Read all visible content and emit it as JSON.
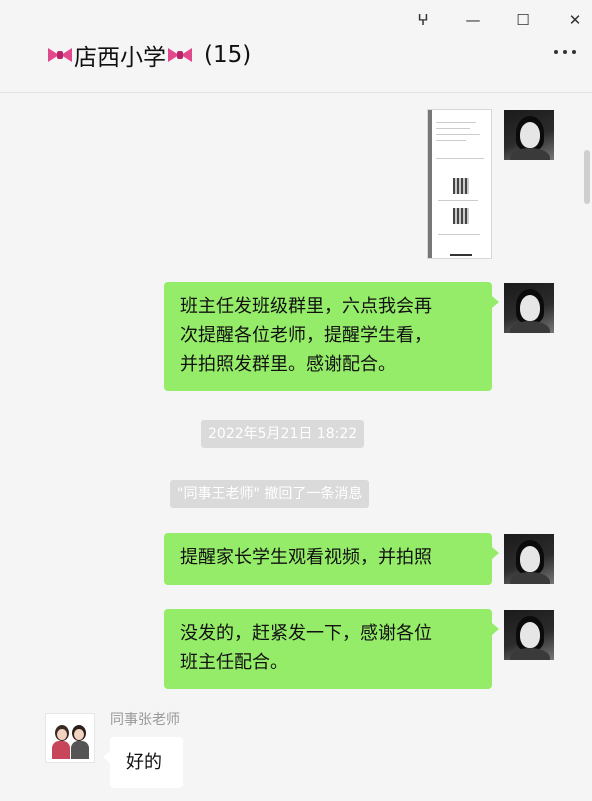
{
  "window": {
    "pin_icon": "pin-icon",
    "pin_glyph": "ⵖ",
    "minimize_icon": "minimize-icon",
    "minimize_glyph": "—",
    "maximize_icon": "maximize-icon",
    "maximize_glyph": "☐",
    "close_icon": "close-icon",
    "close_glyph": "✕"
  },
  "chat": {
    "title": "店西小学",
    "member_count": "(15)",
    "title_decoration_icon": "pink-bow-icon",
    "more_icon": "more-icon"
  },
  "messages": [
    {
      "type": "image",
      "direction": "out"
    },
    {
      "type": "text",
      "direction": "out",
      "lines": [
        "班主任发班级群里，六点我会再",
        "次提醒各位老师，提醒学生看，",
        "并拍照发群里。感谢配合。"
      ]
    },
    {
      "type": "time",
      "text": "2022年5月21日 18:22"
    },
    {
      "type": "system",
      "text": "\"同事王老师\" 撤回了一条消息"
    },
    {
      "type": "text",
      "direction": "out",
      "lines": [
        "提醒家长学生观看视频，并拍照"
      ]
    },
    {
      "type": "text",
      "direction": "out",
      "lines": [
        "没发的，赶紧发一下，感谢各位",
        "班主任配合。"
      ]
    },
    {
      "type": "text",
      "direction": "in",
      "sender": "同事张老师",
      "lines": [
        "好的"
      ]
    }
  ],
  "colors": {
    "outgoing_bubble": "#95ec69",
    "incoming_bubble": "#ffffff",
    "background": "#f5f5f5"
  }
}
